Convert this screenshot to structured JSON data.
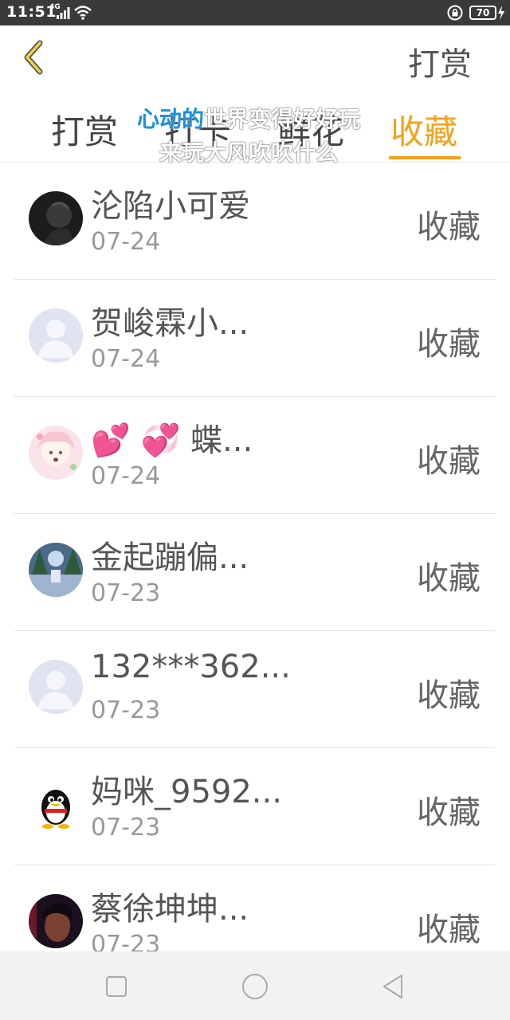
{
  "status_bar": {
    "time": "11:51",
    "network": "4G",
    "battery": "70"
  },
  "header": {
    "back_icon": "chevron-left-icon",
    "title": "打赏",
    "accent_color": "#f6a11a"
  },
  "tabs": [
    {
      "label": "打赏",
      "active": false
    },
    {
      "label": "打卡",
      "active": false
    },
    {
      "label": "鲜花",
      "active": false
    },
    {
      "label": "收藏",
      "active": true
    }
  ],
  "overlay": {
    "line1_highlight": "心动的",
    "line1_rest": "世界变得好好玩",
    "line2": "来玩大风吹吹什么"
  },
  "list": [
    {
      "name": "沦陷小可爱",
      "date": "07-24",
      "action": "收藏",
      "avatar": "dark-photo"
    },
    {
      "name": "贺峻霖小...",
      "date": "07-24",
      "action": "收藏",
      "avatar": "default-person"
    },
    {
      "name": "💕 💞 蝶...",
      "date": "07-24",
      "action": "收藏",
      "avatar": "anime-girl"
    },
    {
      "name": "金起蹦偏...",
      "date": "07-23",
      "action": "收藏",
      "avatar": "forest-photo"
    },
    {
      "name": "132***362...",
      "date": "07-23",
      "action": "收藏",
      "avatar": "default-person"
    },
    {
      "name": "妈咪_9592...",
      "date": "07-23",
      "action": "收藏",
      "avatar": "qq-penguin"
    },
    {
      "name": "蔡徐坤坤...",
      "date": "07-23",
      "action": "收藏",
      "avatar": "portrait-photo"
    }
  ],
  "nav": {
    "recent": "square-icon",
    "home": "circle-icon",
    "back": "triangle-back-icon"
  }
}
